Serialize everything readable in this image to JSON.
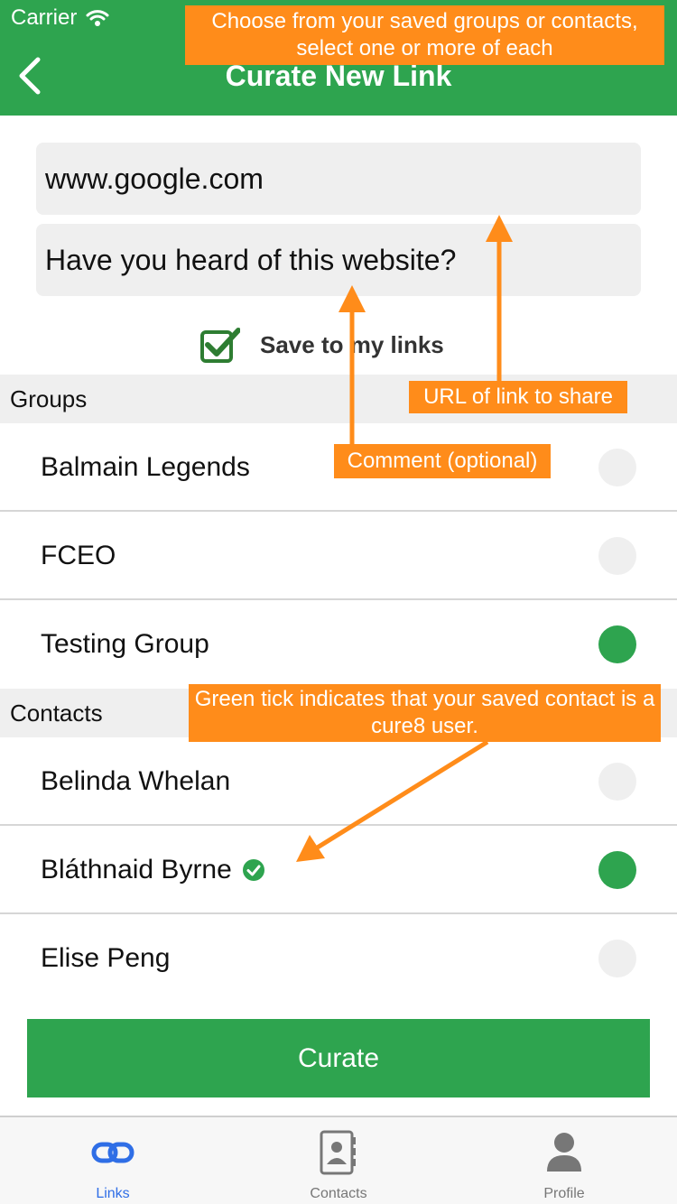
{
  "status": {
    "carrier": "Carrier"
  },
  "header": {
    "title": "Curate New Link",
    "back_label": "Back"
  },
  "form": {
    "url_value": "www.google.com",
    "comment_value": "Have you heard of this website?",
    "save_label": "Save to my links",
    "save_checked": true
  },
  "groups": {
    "heading": "Groups",
    "items": [
      {
        "name": "Balmain Legends",
        "selected": false
      },
      {
        "name": "FCEO",
        "selected": false
      },
      {
        "name": "Testing Group",
        "selected": true
      }
    ]
  },
  "contacts": {
    "heading": "Contacts",
    "items": [
      {
        "name": "Belinda Whelan",
        "selected": false,
        "cure8_user": false
      },
      {
        "name": "Bláthnaid Byrne",
        "selected": true,
        "cure8_user": true
      },
      {
        "name": "Elise Peng",
        "selected": false,
        "cure8_user": false
      }
    ]
  },
  "curate_button": "Curate",
  "tabbar": {
    "tabs": [
      {
        "label": "Links",
        "icon": "link-icon",
        "active": true
      },
      {
        "label": "Contacts",
        "icon": "contacts-book-icon",
        "active": false
      },
      {
        "label": "Profile",
        "icon": "person-icon",
        "active": false
      }
    ]
  },
  "annotations": {
    "top": "Choose from your saved groups or contacts, select one or more of each",
    "url": "URL of link to share",
    "comment": "Comment (optional)",
    "tick": "Green tick indicates that your saved contact is a cure8 user."
  },
  "colors": {
    "brand_green": "#2ea44f",
    "annotation_orange": "#ff8c1a",
    "active_tab_blue": "#2f6ee6",
    "radio_off": "#efefef"
  }
}
